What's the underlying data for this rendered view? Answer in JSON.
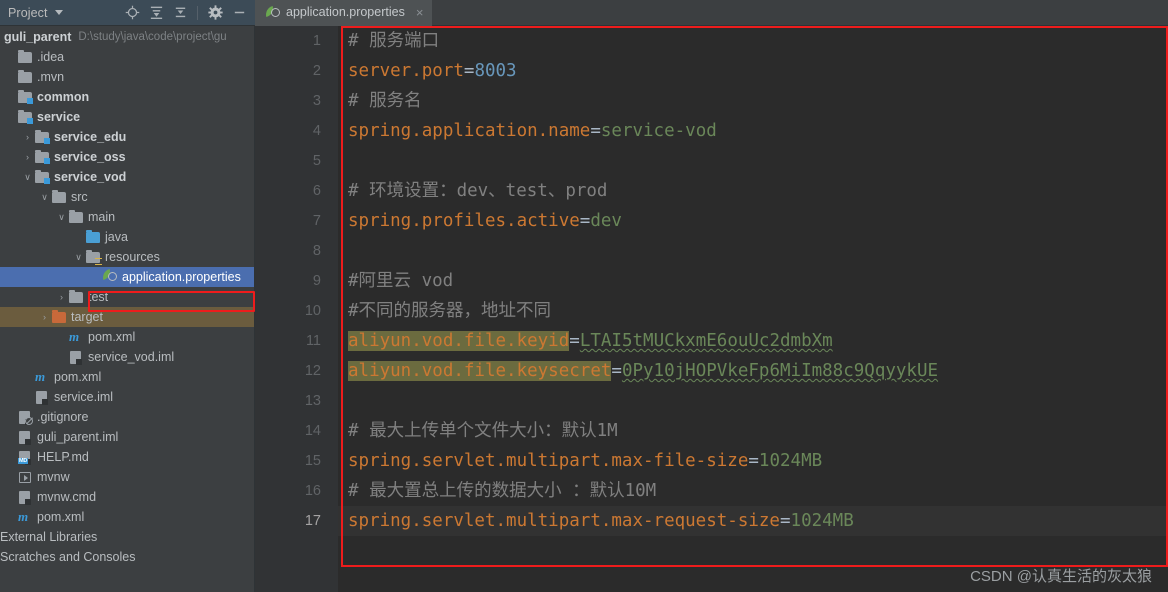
{
  "toolbar": {
    "project_label": "Project",
    "dropdown_icon": "chevron-down-icon",
    "icons": [
      {
        "name": "locate-target-icon",
        "title": "Select Opened File"
      },
      {
        "name": "expand-all-icon",
        "title": "Expand All"
      },
      {
        "name": "collapse-all-icon",
        "title": "Collapse All"
      },
      {
        "name": "settings-gear-icon",
        "title": "Settings"
      },
      {
        "name": "minimize-icon",
        "title": "Hide"
      }
    ]
  },
  "tabs": [
    {
      "label": "application.properties",
      "icon": "properties-file-icon",
      "close": "×",
      "active": true
    }
  ],
  "sidebar": {
    "root": {
      "label": "guli_parent",
      "path": "D:\\study\\java\\code\\project\\gu"
    },
    "items": [
      {
        "label": ".idea",
        "indent": 0,
        "arrow": "",
        "icon": "folder-icon",
        "style": "plain"
      },
      {
        "label": ".mvn",
        "indent": 0,
        "arrow": "",
        "icon": "folder-icon",
        "style": "plain"
      },
      {
        "label": "common",
        "indent": 0,
        "arrow": "",
        "icon": "module-folder-icon",
        "style": "bold"
      },
      {
        "label": "service",
        "indent": 0,
        "arrow": "",
        "icon": "module-folder-icon",
        "style": "bold"
      },
      {
        "label": "service_edu",
        "indent": 1,
        "arrow": "›",
        "icon": "module-folder-icon",
        "style": "bold"
      },
      {
        "label": "service_oss",
        "indent": 1,
        "arrow": "›",
        "icon": "module-folder-icon",
        "style": "bold"
      },
      {
        "label": "service_vod",
        "indent": 1,
        "arrow": "⌄",
        "icon": "module-folder-icon",
        "style": "bold"
      },
      {
        "label": "src",
        "indent": 2,
        "arrow": "⌄",
        "icon": "folder-icon",
        "style": "plain"
      },
      {
        "label": "main",
        "indent": 3,
        "arrow": "⌄",
        "icon": "folder-icon",
        "style": "plain"
      },
      {
        "label": "java",
        "indent": 4,
        "arrow": "",
        "icon": "source-folder-icon",
        "style": "plain"
      },
      {
        "label": "resources",
        "indent": 4,
        "arrow": "⌄",
        "icon": "resources-folder-icon",
        "style": "plain"
      },
      {
        "label": "application.properties",
        "indent": 5,
        "arrow": "",
        "icon": "properties-file-icon",
        "style": "selected"
      },
      {
        "label": "test",
        "indent": 3,
        "arrow": "›",
        "icon": "folder-icon",
        "style": "plain"
      },
      {
        "label": "target",
        "indent": 2,
        "arrow": "›",
        "icon": "excluded-folder-icon",
        "style": "target"
      },
      {
        "label": "pom.xml",
        "indent": 3,
        "arrow": "",
        "icon": "maven-file-icon",
        "style": "plain"
      },
      {
        "label": "service_vod.iml",
        "indent": 3,
        "arrow": "",
        "icon": "iml-file-icon",
        "style": "plain"
      },
      {
        "label": "pom.xml",
        "indent": 1,
        "arrow": "",
        "icon": "maven-file-icon",
        "style": "plain"
      },
      {
        "label": "service.iml",
        "indent": 1,
        "arrow": "",
        "icon": "iml-file-icon",
        "style": "plain"
      },
      {
        "label": ".gitignore",
        "indent": 0,
        "arrow": "",
        "icon": "gitignore-file-icon",
        "style": "plain"
      },
      {
        "label": "guli_parent.iml",
        "indent": 0,
        "arrow": "",
        "icon": "iml-file-icon",
        "style": "plain"
      },
      {
        "label": "HELP.md",
        "indent": 0,
        "arrow": "",
        "icon": "markdown-file-icon",
        "style": "plain"
      },
      {
        "label": "mvnw",
        "indent": 0,
        "arrow": "",
        "icon": "shell-script-icon",
        "style": "plain"
      },
      {
        "label": "mvnw.cmd",
        "indent": 0,
        "arrow": "",
        "icon": "cmd-file-icon",
        "style": "plain"
      },
      {
        "label": "pom.xml",
        "indent": 0,
        "arrow": "",
        "icon": "maven-file-icon",
        "style": "plain"
      },
      {
        "label": "External Libraries",
        "indent": -1,
        "arrow": "",
        "icon": "none",
        "style": "plain"
      },
      {
        "label": "Scratches and Consoles",
        "indent": -1,
        "arrow": "",
        "icon": "none",
        "style": "plain"
      }
    ]
  },
  "editor": {
    "gutter": [
      "1",
      "2",
      "3",
      "4",
      "5",
      "6",
      "7",
      "8",
      "9",
      "10",
      "11",
      "12",
      "13",
      "14",
      "15",
      "16",
      "17"
    ],
    "current_line": 17,
    "lines": [
      {
        "n": 1,
        "segments": [
          {
            "t": "# 服务端口",
            "c": "cmt"
          }
        ]
      },
      {
        "n": 2,
        "segments": [
          {
            "t": "server.port",
            "c": "key"
          },
          {
            "t": "=",
            "c": "eq"
          },
          {
            "t": "8003",
            "c": "num"
          }
        ]
      },
      {
        "n": 3,
        "segments": [
          {
            "t": "# 服务名",
            "c": "cmt"
          }
        ]
      },
      {
        "n": 4,
        "segments": [
          {
            "t": "spring.application.name",
            "c": "key"
          },
          {
            "t": "=",
            "c": "eq"
          },
          {
            "t": "service-vod",
            "c": "val"
          }
        ]
      },
      {
        "n": 5,
        "segments": []
      },
      {
        "n": 6,
        "segments": [
          {
            "t": "# 环境设置：dev、test、prod",
            "c": "cmt"
          }
        ]
      },
      {
        "n": 7,
        "segments": [
          {
            "t": "spring.profiles.active",
            "c": "key"
          },
          {
            "t": "=",
            "c": "eq"
          },
          {
            "t": "dev",
            "c": "val"
          }
        ]
      },
      {
        "n": 8,
        "segments": []
      },
      {
        "n": 9,
        "segments": [
          {
            "t": "#阿里云 vod",
            "c": "cmt"
          }
        ]
      },
      {
        "n": 10,
        "segments": [
          {
            "t": "#不同的服务器，地址不同",
            "c": "cmt"
          }
        ]
      },
      {
        "n": 11,
        "segments": [
          {
            "t": "aliyun.vod.file.keyid",
            "c": "key hl"
          },
          {
            "t": "=",
            "c": "eq"
          },
          {
            "t": "LTAI5tMUCkxmE6ouUc2dmbXm",
            "c": "val squig"
          }
        ]
      },
      {
        "n": 12,
        "segments": [
          {
            "t": "aliyun.vod.file.keysecret",
            "c": "key hl"
          },
          {
            "t": "=",
            "c": "eq"
          },
          {
            "t": "0Py10jHOPVkeFp6MiIm88c9QqyykUE",
            "c": "val squig"
          }
        ]
      },
      {
        "n": 13,
        "segments": []
      },
      {
        "n": 14,
        "segments": [
          {
            "t": "# 最大上传单个文件大小：默认1M",
            "c": "cmt"
          }
        ]
      },
      {
        "n": 15,
        "segments": [
          {
            "t": "spring.servlet.multipart.max-file-size",
            "c": "key"
          },
          {
            "t": "=",
            "c": "eq"
          },
          {
            "t": "1024MB",
            "c": "val"
          }
        ]
      },
      {
        "n": 16,
        "segments": [
          {
            "t": "# 最大置总上传的数据大小 ：默认10M",
            "c": "cmt"
          }
        ]
      },
      {
        "n": 17,
        "segments": [
          {
            "t": "spring.servlet.multipart.max-request-size",
            "c": "key"
          },
          {
            "t": "=",
            "c": "eq"
          },
          {
            "t": "1024MB",
            "c": "val"
          }
        ]
      }
    ]
  },
  "watermark": {
    "text": "CSDN @认真生活的灰太狼"
  },
  "colors": {
    "annotation_red": "#ee1c1c",
    "selection_blue": "#4b6eaf",
    "key_orange": "#cc7832",
    "value_green": "#6a8759",
    "number_blue": "#6897bb",
    "comment_gray": "#808080",
    "highlight_olive": "#6b6b3f",
    "editor_bg": "#2b2b2b",
    "panel_bg": "#3c3f41"
  }
}
